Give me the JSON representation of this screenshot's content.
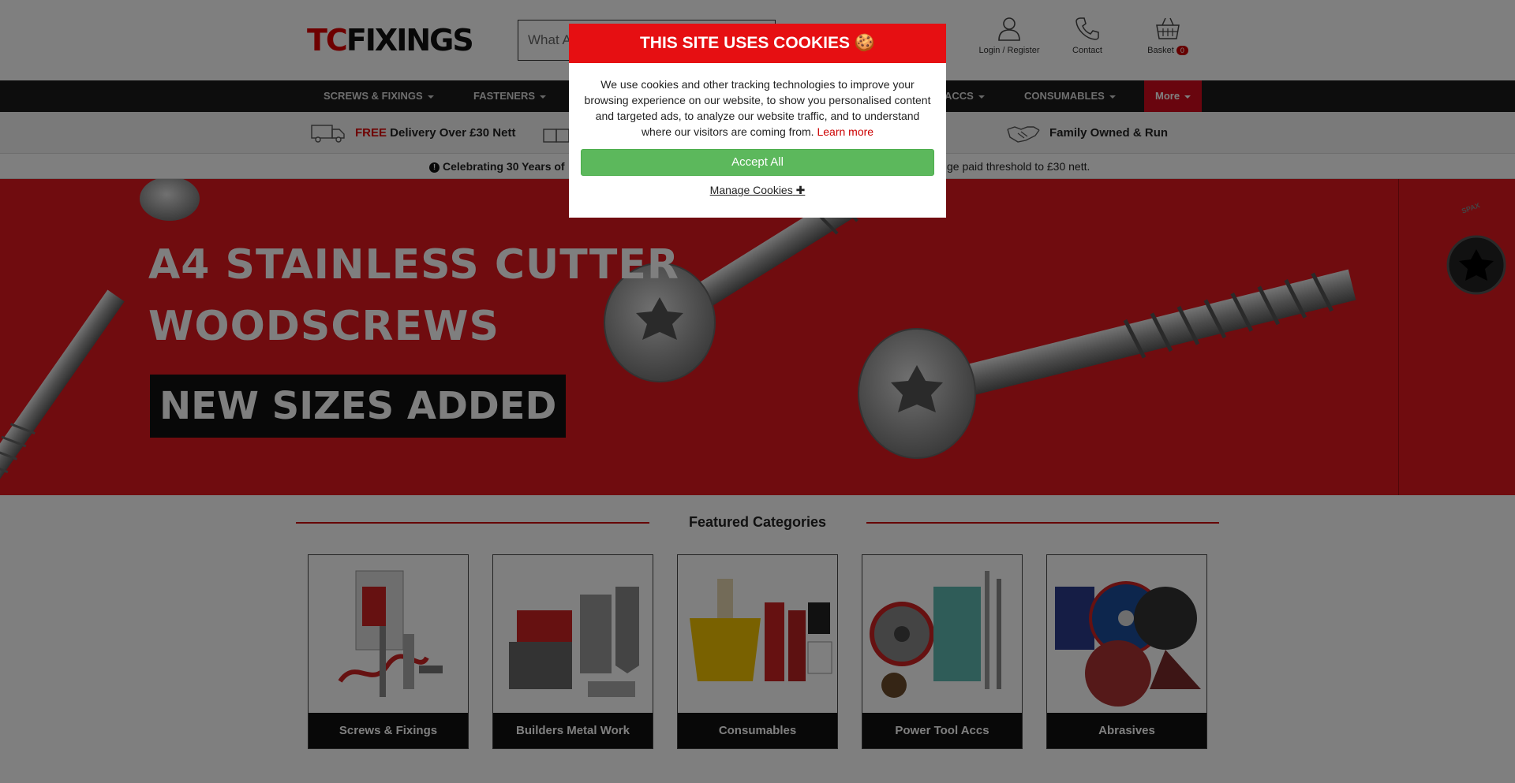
{
  "header": {
    "logo_tc": "TC",
    "logo_fixings": "FIXINGS",
    "search_placeholder": "What Are You Looking For?",
    "search_visible": "What A",
    "login_label": "Login / Register",
    "contact_label": "Contact",
    "basket_label": "Basket",
    "basket_count": "0",
    "partial_text": "t"
  },
  "nav": {
    "items": [
      {
        "label": "SCREWS & FIXINGS"
      },
      {
        "label": "FASTENERS"
      },
      {
        "label": "ACCS"
      },
      {
        "label": "CONSUMABLES"
      },
      {
        "label": "More"
      }
    ]
  },
  "usp": {
    "delivery_free": "FREE",
    "delivery_rest": " Delivery Over £30 Nett",
    "family": "Family Owned & Run"
  },
  "announcement": {
    "left": "Celebrating 30 Years of",
    "right": "ge paid threshold to £30 nett."
  },
  "hero": {
    "title_line1": "A4 STAINLESS CUTTER",
    "title_line2": "WOODSCREWS",
    "tag": "NEW SIZES ADDED",
    "side_logo": "SPAX"
  },
  "featured": {
    "title": "Featured Categories",
    "categories": [
      {
        "label": "Screws & Fixings"
      },
      {
        "label": "Builders Metal Work"
      },
      {
        "label": "Consumables"
      },
      {
        "label": "Power Tool Accs"
      },
      {
        "label": "Abrasives"
      }
    ]
  },
  "cookie": {
    "title": "THIS SITE USES COOKIES",
    "title_icon": "🍪",
    "body": "We use cookies and other tracking technologies to improve your browsing experience on our website, to show you personalised content and targeted ads, to analyze our website traffic, and to understand where our visitors are coming from.",
    "learn_more": "Learn more",
    "accept": "Accept All",
    "manage": "Manage Cookies",
    "manage_icon": "✚"
  },
  "colors": {
    "brand_red": "#e1181f",
    "accept_green": "#5cb85c",
    "nav_dark": "#1a1a1a"
  }
}
